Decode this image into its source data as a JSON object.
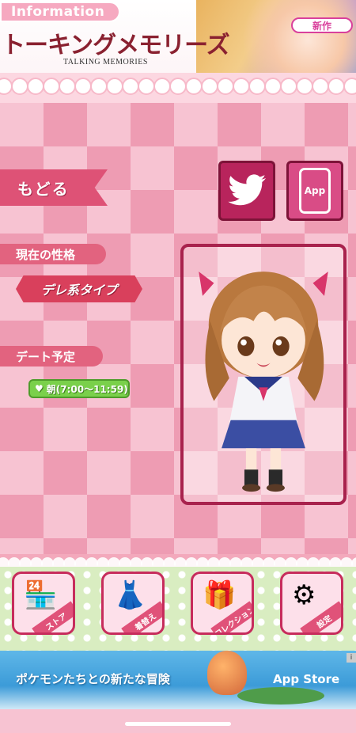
{
  "header": {
    "info_tab": "Information",
    "logo": "トーキングメモリーズ",
    "logo_sub": "TALKING MEMORIES",
    "new_badge": "新作"
  },
  "nav": {
    "back_label": "もどる",
    "app_label": "App"
  },
  "status": {
    "personality_label": "現在の性格",
    "personality_value": "デレ系タイプ",
    "date_label": "デート予定",
    "date_value": "朝(7:00〜11:59)"
  },
  "menu": {
    "items": [
      {
        "label": "ストア",
        "icon": "shop-icon"
      },
      {
        "label": "着替え",
        "icon": "outfit-icon"
      },
      {
        "label": "コレクション",
        "icon": "gift-icon"
      },
      {
        "label": "設定",
        "icon": "gear-icon"
      }
    ]
  },
  "ad": {
    "text": "ポケモンたちとの新たな冒険",
    "store": "App Store",
    "info": "i"
  },
  "colors": {
    "accent": "#de5276",
    "frame": "#a8224d",
    "pill": "#7ad04b"
  }
}
